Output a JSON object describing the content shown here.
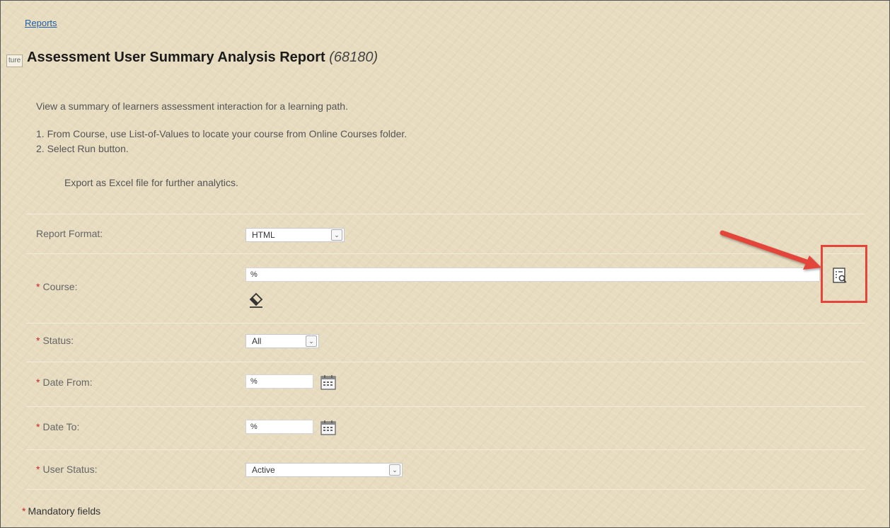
{
  "breadcrumb": {
    "label": "Reports"
  },
  "feature_tab": {
    "label": "ture"
  },
  "page": {
    "title": "Assessment User Summary Analysis Report",
    "report_id": "(68180)",
    "description": "View a summary of learners assessment interaction for a learning path.",
    "steps": [
      "1. From Course, use List-of-Values to locate your course from Online Courses folder.",
      "2. Select Run button."
    ],
    "export_note": "Export as Excel file for further analytics."
  },
  "form": {
    "report_format": {
      "label": "Report Format:",
      "value": "HTML"
    },
    "course": {
      "label": "Course:",
      "value": "%"
    },
    "status": {
      "label": "Status:",
      "value": "All"
    },
    "date_from": {
      "label": "Date From:",
      "value": "%"
    },
    "date_to": {
      "label": "Date To:",
      "value": "%"
    },
    "user_status": {
      "label": "User Status:",
      "value": "Active"
    },
    "required_marker": "*"
  },
  "footer": {
    "mandatory_note": "Mandatory fields"
  },
  "icons": {
    "calendar": "calendar-icon",
    "eraser": "eraser-icon",
    "list_of_values": "list-of-values-search-icon",
    "dropdown": "chevron-down-icon"
  },
  "colors": {
    "background": "#e7dcc0",
    "link": "#1f5fa8",
    "required": "#c8252c",
    "annotation": "#e3453b"
  }
}
